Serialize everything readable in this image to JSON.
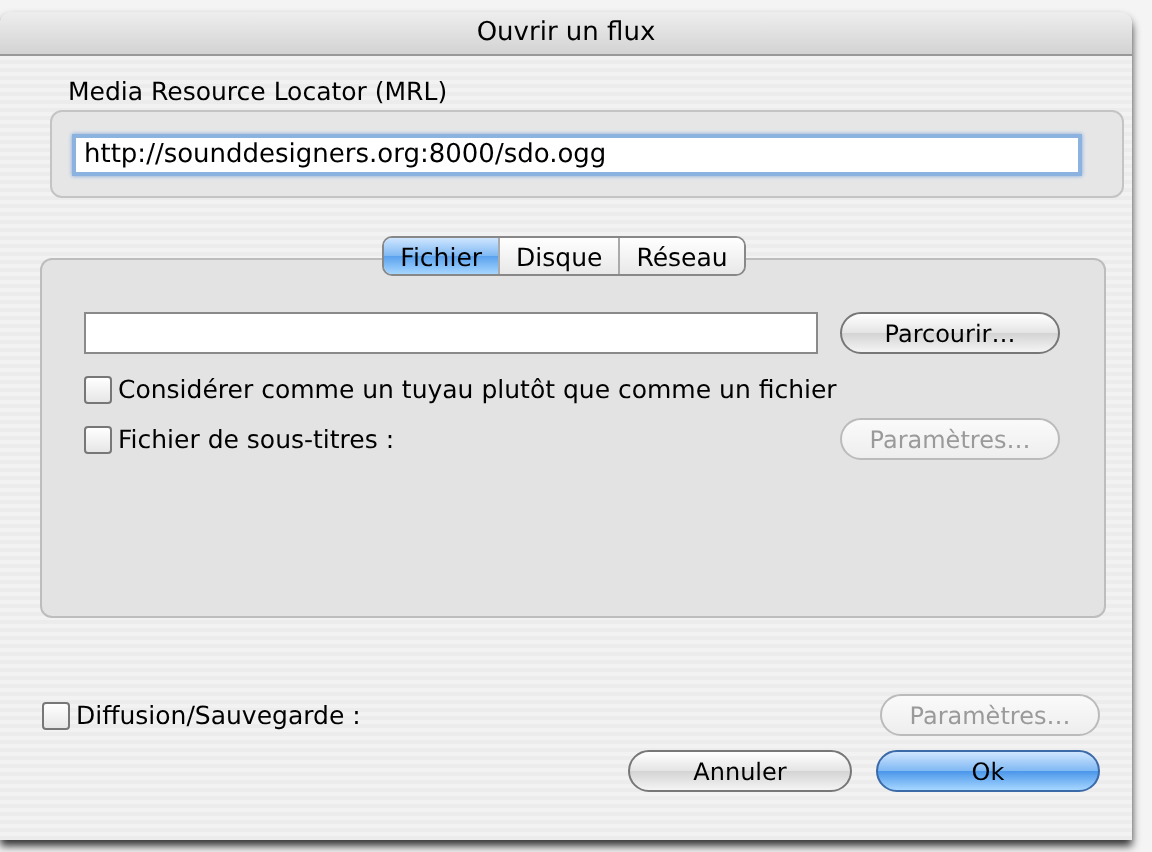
{
  "window": {
    "title": "Ouvrir un flux"
  },
  "mrl": {
    "label": "Media Resource Locator (MRL)",
    "value": "http://sounddesigners.org:8000/sdo.ogg"
  },
  "tabs": [
    {
      "label": "Fichier",
      "selected": true
    },
    {
      "label": "Disque",
      "selected": false
    },
    {
      "label": "Réseau",
      "selected": false
    }
  ],
  "file_panel": {
    "browse_button": {
      "label": "Parcourir…",
      "disabled": false
    },
    "options": [
      {
        "label": "Considérer comme un tuyau plutôt que comme un fichier",
        "checked": false
      },
      {
        "label": "Fichier de sous-titres :",
        "checked": false,
        "button": {
          "label": "Paramètres…",
          "disabled": true
        }
      }
    ]
  },
  "stream_output": {
    "label": "Diffusion/Sauvegarde :",
    "checked": false,
    "button": {
      "label": "Paramètres…",
      "disabled": true
    }
  },
  "buttons": [
    {
      "label": "Annuler",
      "default": false
    },
    {
      "label": "Ok",
      "default": true
    }
  ]
}
